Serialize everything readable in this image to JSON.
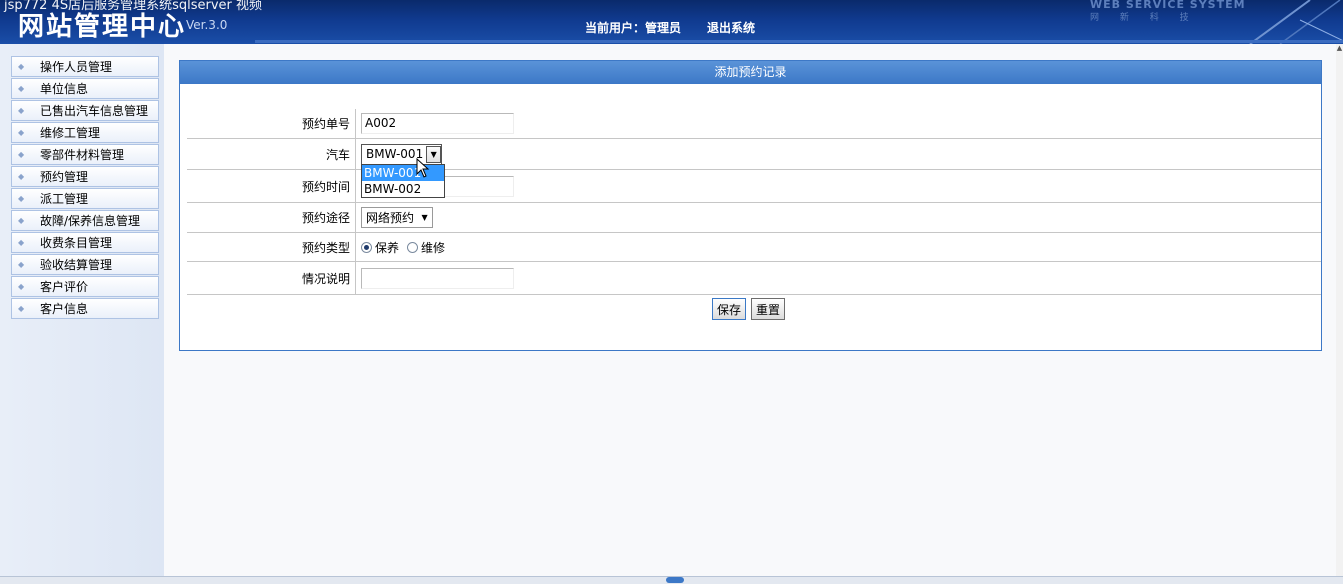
{
  "header": {
    "overlay_caption": "jsp772 4S店后服务管理系统sqlserver 视频",
    "logo_text": "网站管理中心",
    "version": "Ver.3.0",
    "current_user_label": "当前用户：管理员",
    "logout_label": "退出系统",
    "brand_text": "WEB SERVICE SYSTEM",
    "brand_sub": "网 新 科 技"
  },
  "sidebar": {
    "items": [
      {
        "label": "操作人员管理"
      },
      {
        "label": "单位信息"
      },
      {
        "label": "已售出汽车信息管理"
      },
      {
        "label": "维修工管理"
      },
      {
        "label": "零部件材料管理"
      },
      {
        "label": "预约管理"
      },
      {
        "label": "派工管理"
      },
      {
        "label": "故障/保养信息管理"
      },
      {
        "label": "收费条目管理"
      },
      {
        "label": "验收结算管理"
      },
      {
        "label": "客户评价"
      },
      {
        "label": "客户信息"
      }
    ]
  },
  "panel": {
    "title": "添加预约记录",
    "fields": {
      "order_no": {
        "label": "预约单号",
        "value": "A002"
      },
      "car": {
        "label": "汽车",
        "value": "BMW-001",
        "options": [
          "BMW-001",
          "BMW-002"
        ],
        "highlighted": "BMW-001"
      },
      "time": {
        "label": "预约时间",
        "value": ""
      },
      "channel": {
        "label": "预约途径",
        "value": "网络预约"
      },
      "type": {
        "label": "预约类型",
        "options": [
          "保养",
          "维修"
        ],
        "selected": "保养"
      },
      "remarks": {
        "label": "情况说明",
        "value": ""
      }
    },
    "buttons": {
      "save": "保存",
      "reset": "重置"
    }
  },
  "colors": {
    "header_bg": "#103a8f",
    "panel_border": "#3d78c6",
    "panel_title_bg": "#3c78c7",
    "dropdown_highlight": "#3399ff"
  }
}
